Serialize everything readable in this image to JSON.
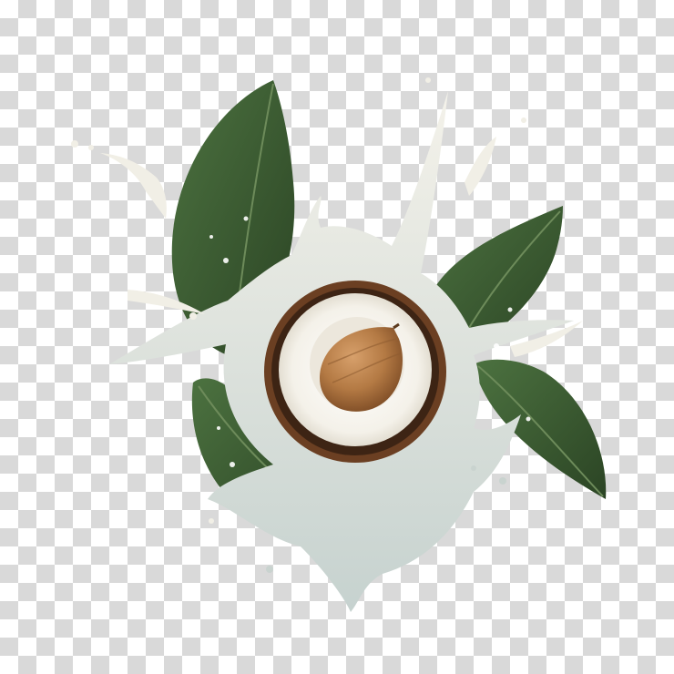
{
  "image": {
    "subject": "coconut-milk-splash",
    "elements": [
      "halved-coconut",
      "coconut-seed",
      "milk-splash",
      "green-leaves",
      "transparent-checkerboard-background"
    ],
    "colors": {
      "leaf_dark": "#2f4a28",
      "leaf_mid": "#3f6234",
      "leaf_vein": "#6d8b5a",
      "milk": "#f1efe6",
      "milk_shadow": "#c9d3cf",
      "coconut_shell": "#6b3f22",
      "coconut_flesh": "#f7f5ef",
      "seed": "#b47a44",
      "checker_light": "#ffffff",
      "checker_dark": "#d9d9d9"
    }
  }
}
